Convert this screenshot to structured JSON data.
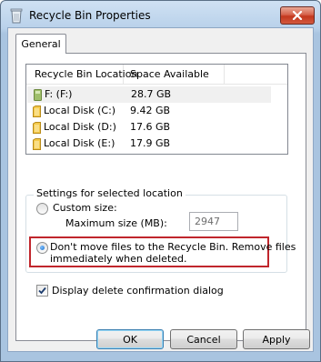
{
  "window": {
    "title": "Recycle Bin Properties",
    "close_label": "✕",
    "accent": "#c0262c"
  },
  "tabs": [
    {
      "label": "General",
      "selected": true
    }
  ],
  "listview": {
    "columns": [
      "Recycle Bin Location",
      "Space Available"
    ],
    "rows": [
      {
        "name": "F: (F:)",
        "space": "28.7 GB",
        "icon": "removable-drive-icon",
        "selected": true
      },
      {
        "name": "Local Disk (C:)",
        "space": "9.42 GB",
        "icon": "folder-drive-icon",
        "selected": false
      },
      {
        "name": "Local Disk (D:)",
        "space": "17.6 GB",
        "icon": "folder-drive-icon",
        "selected": false
      },
      {
        "name": "Local Disk (E:)",
        "space": "17.9 GB",
        "icon": "folder-drive-icon",
        "selected": false
      }
    ]
  },
  "settings": {
    "group_label": "Settings for selected location",
    "custom_size_label": "Custom size:",
    "max_size_label": "Maximum size (MB):",
    "max_size_value": "2947",
    "dont_move_label_line1": "Don't move files to the Recycle Bin. Remove files",
    "dont_move_label_line2": "immediately when deleted.",
    "selected_option": "dont_move"
  },
  "confirm_dialog": {
    "label": "Display delete confirmation dialog",
    "checked": true
  },
  "buttons": {
    "ok": "OK",
    "cancel": "Cancel",
    "apply": "Apply"
  }
}
